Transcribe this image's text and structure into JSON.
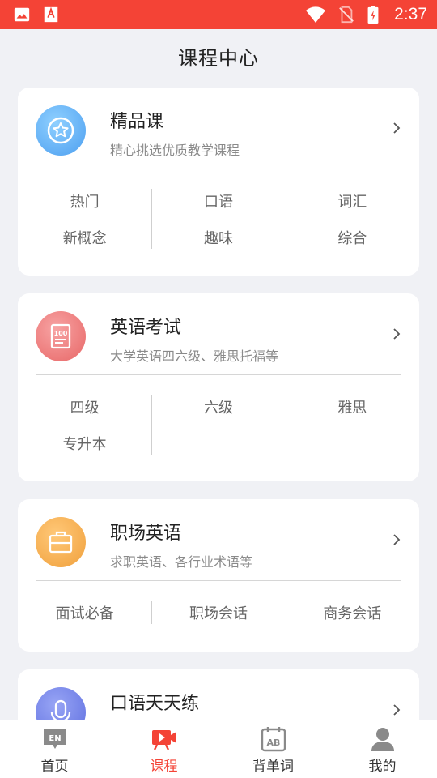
{
  "status_bar": {
    "time": "2:37",
    "icons": [
      "image-icon",
      "pdf-app-icon",
      "wifi-icon",
      "no-sim-icon",
      "battery-charging-icon"
    ]
  },
  "header": {
    "title": "课程中心"
  },
  "cards": [
    {
      "title": "精品课",
      "subtitle": "精心挑选优质教学课程",
      "icon": "star-badge-icon",
      "tags": [
        [
          "热门",
          "新概念"
        ],
        [
          "口语",
          "趣味"
        ],
        [
          "词汇",
          "综合"
        ]
      ]
    },
    {
      "title": "英语考试",
      "subtitle": "大学英语四六级、雅思托福等",
      "icon": "exam-100-icon",
      "tags": [
        [
          "四级",
          "专升本"
        ],
        [
          "六级"
        ],
        [
          "雅思"
        ]
      ]
    },
    {
      "title": "职场英语",
      "subtitle": "求职英语、各行业术语等",
      "icon": "briefcase-icon",
      "tags": [
        [
          "面试必备"
        ],
        [
          "职场会话"
        ],
        [
          "商务会话"
        ]
      ]
    },
    {
      "title": "口语天天练",
      "subtitle": "",
      "icon": "microphone-icon",
      "tags": []
    }
  ],
  "bottom_nav": [
    {
      "label": "首页",
      "icon": "en-home-icon",
      "active": false
    },
    {
      "label": "课程",
      "icon": "video-course-icon",
      "active": true
    },
    {
      "label": "背单词",
      "icon": "ab-calendar-icon",
      "active": false
    },
    {
      "label": "我的",
      "icon": "user-icon",
      "active": false
    }
  ],
  "colors": {
    "accent": "#f44336",
    "background": "#f0f1f5",
    "icon_blue": "#5aa9f0",
    "icon_red": "#ee7a7a",
    "icon_orange": "#f3aa4a",
    "icon_purple": "#6f7fe6"
  }
}
